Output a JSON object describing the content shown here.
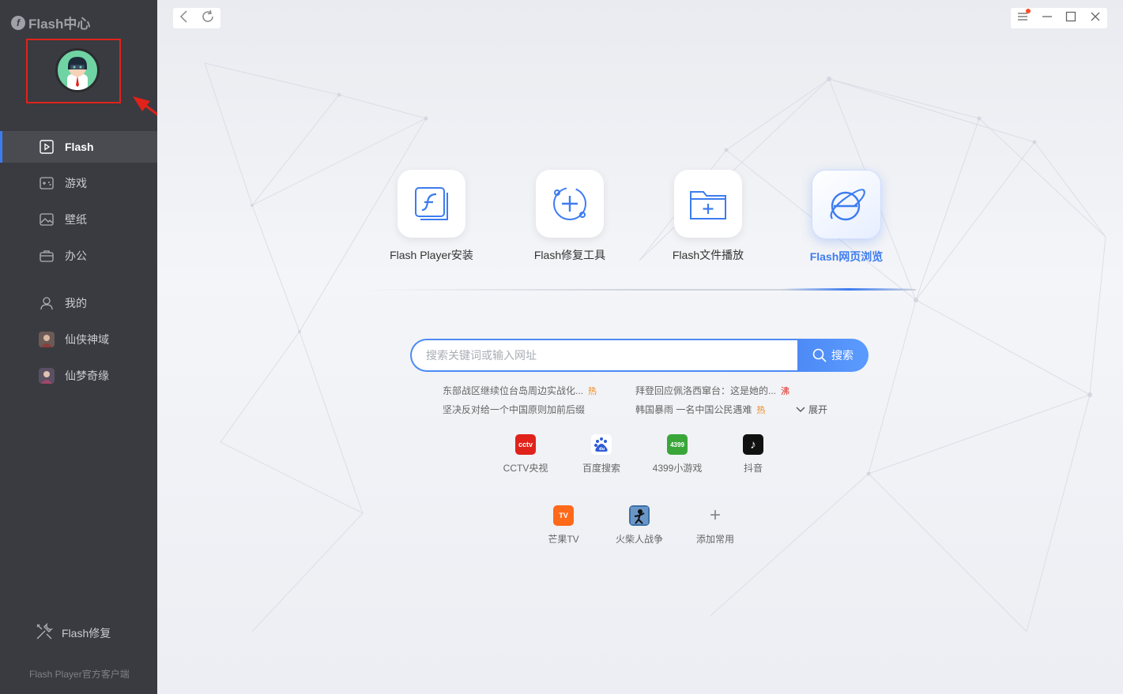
{
  "app": {
    "logo_text": "Flash中心",
    "logo_letter": "f"
  },
  "sidebar": {
    "items": [
      {
        "label": "Flash",
        "active": true,
        "icon": "play-icon"
      },
      {
        "label": "游戏",
        "icon": "gamepad-icon"
      },
      {
        "label": "壁纸",
        "icon": "image-icon"
      },
      {
        "label": "办公",
        "icon": "briefcase-icon"
      },
      {
        "label": "我的",
        "icon": "user-icon"
      },
      {
        "label": "仙侠神域",
        "icon": "game-avatar-icon"
      },
      {
        "label": "仙梦奇缘",
        "icon": "game-avatar-icon"
      }
    ],
    "repair_label": "Flash修复",
    "footer": "Flash Player官方客户端"
  },
  "tools": [
    {
      "label": "Flash Player安装",
      "icon": "flash-install-icon"
    },
    {
      "label": "Flash修复工具",
      "icon": "repair-tool-icon"
    },
    {
      "label": "Flash文件播放",
      "icon": "folder-add-icon"
    },
    {
      "label": "Flash网页浏览",
      "icon": "browser-icon",
      "active": true
    }
  ],
  "search": {
    "placeholder": "搜索关键词或输入网址",
    "button": "搜索"
  },
  "hot": [
    {
      "text": "东部战区继续位台岛周边实战化...",
      "tag": "热",
      "tag_color": "#f08a1c"
    },
    {
      "text": "拜登回应佩洛西窜台：这是她的...",
      "tag": "沸",
      "tag_color": "#e0221a"
    },
    {
      "text": "坚决反对给一个中国原则加前后缀",
      "tag": ""
    },
    {
      "text": "韩国暴雨 一名中国公民遇难",
      "tag": "热",
      "tag_color": "#f08a1c"
    }
  ],
  "expand_label": "展开",
  "sites": [
    {
      "label": "CCTV央视",
      "icon_text": "cctv",
      "color": "#e0221a"
    },
    {
      "label": "百度搜索",
      "icon_text": "du",
      "color": "#2e5bd8"
    },
    {
      "label": "4399小游戏",
      "icon_text": "4399",
      "color": "#3aa63a"
    },
    {
      "label": "抖音",
      "icon_text": "♪",
      "color": "#111111"
    },
    {
      "label": "芒果TV",
      "icon_text": "TV",
      "color": "#ff6a1a"
    },
    {
      "label": "火柴人战争",
      "icon_text": "",
      "color": "#3b6fa8"
    },
    {
      "label": "添加常用",
      "icon_text": "+",
      "color": "transparent"
    }
  ],
  "colors": {
    "accent": "#3d7cf0",
    "sidebar_bg": "#3a3b40",
    "highlight_box": "#e0221a"
  }
}
